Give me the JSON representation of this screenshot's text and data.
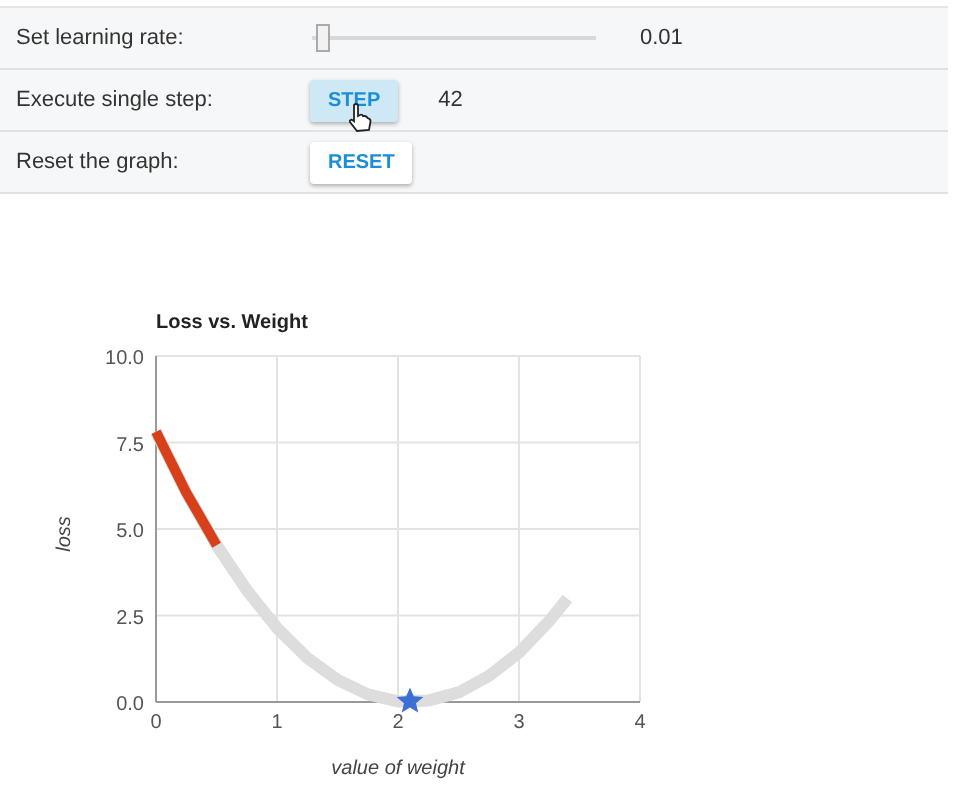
{
  "controls": [
    {
      "kind": "slider",
      "label": "Set learning rate:",
      "level": 0.02,
      "reading": "0.01"
    },
    {
      "kind": "button",
      "label": "Execute single step:",
      "button": "STEP",
      "pressed": true,
      "reading": "42"
    },
    {
      "kind": "button",
      "label": "Reset the graph:",
      "button": "RESET",
      "pressed": false
    }
  ],
  "chart": {
    "chart_data": {
      "type": "line",
      "title": "Loss vs. Weight",
      "xlabel": "value of weight",
      "ylabel": "loss",
      "x": [
        0,
        0.25,
        0.5,
        0.75,
        1,
        1.25,
        1.5,
        1.75,
        2,
        2.25,
        2.5,
        2.75,
        3,
        3.25,
        3.4
      ],
      "series": [
        {
          "color": "#dddddd",
          "values": [
            7.81,
            6.06,
            4.53,
            3.23,
            2.14,
            1.28,
            0.64,
            0.22,
            0.02,
            0.04,
            0.28,
            0.75,
            1.43,
            2.34,
            2.99
          ]
        },
        {
          "color": "#d8401c",
          "values": [
            7.81,
            6.06,
            4.53,
            null,
            null,
            null,
            null,
            null,
            null,
            null,
            null,
            null,
            null,
            null,
            null
          ]
        }
      ],
      "grid": true,
      "xlim": [
        0,
        4
      ],
      "ylim": [
        0,
        10
      ],
      "xticks": [
        0,
        1,
        2,
        3,
        4
      ],
      "yticks": [
        {
          "value": 0,
          "label": "0.0"
        },
        {
          "value": 2.5,
          "label": "2.5"
        },
        {
          "value": 5,
          "label": "5.0"
        },
        {
          "value": 7.5,
          "label": "7.5"
        },
        {
          "value": 10,
          "label": "10.0"
        }
      ]
    }
  }
}
